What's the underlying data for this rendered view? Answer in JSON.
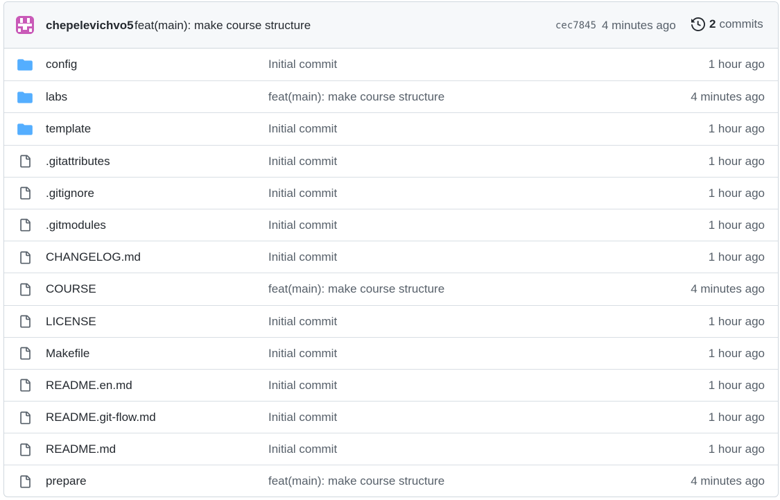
{
  "latest_commit": {
    "author": "chepelevichvo5",
    "message": "feat(main): make course structure",
    "sha": "cec7845",
    "time": "4 minutes ago",
    "commit_count": "2",
    "commits_label": "commits"
  },
  "colors": {
    "folder": "#54aeff",
    "avatar": "#c95ab8",
    "muted": "#57606a",
    "text": "#24292f"
  },
  "files": [
    {
      "type": "folder",
      "icon": "folder-icon",
      "name": "config",
      "message": "Initial commit",
      "time": "1 hour ago"
    },
    {
      "type": "folder",
      "icon": "folder-icon",
      "name": "labs",
      "message": "feat(main): make course structure",
      "time": "4 minutes ago"
    },
    {
      "type": "folder",
      "icon": "folder-icon",
      "name": "template",
      "message": "Initial commit",
      "time": "1 hour ago"
    },
    {
      "type": "file",
      "icon": "file-icon",
      "name": ".gitattributes",
      "message": "Initial commit",
      "time": "1 hour ago"
    },
    {
      "type": "file",
      "icon": "file-icon",
      "name": ".gitignore",
      "message": "Initial commit",
      "time": "1 hour ago"
    },
    {
      "type": "file",
      "icon": "file-icon",
      "name": ".gitmodules",
      "message": "Initial commit",
      "time": "1 hour ago"
    },
    {
      "type": "file",
      "icon": "file-icon",
      "name": "CHANGELOG.md",
      "message": "Initial commit",
      "time": "1 hour ago"
    },
    {
      "type": "file",
      "icon": "file-icon",
      "name": "COURSE",
      "message": "feat(main): make course structure",
      "time": "4 minutes ago"
    },
    {
      "type": "file",
      "icon": "file-icon",
      "name": "LICENSE",
      "message": "Initial commit",
      "time": "1 hour ago"
    },
    {
      "type": "file",
      "icon": "file-icon",
      "name": "Makefile",
      "message": "Initial commit",
      "time": "1 hour ago"
    },
    {
      "type": "file",
      "icon": "file-icon",
      "name": "README.en.md",
      "message": "Initial commit",
      "time": "1 hour ago"
    },
    {
      "type": "file",
      "icon": "file-icon",
      "name": "README.git-flow.md",
      "message": "Initial commit",
      "time": "1 hour ago"
    },
    {
      "type": "file",
      "icon": "file-icon",
      "name": "README.md",
      "message": "Initial commit",
      "time": "1 hour ago"
    },
    {
      "type": "file",
      "icon": "file-icon",
      "name": "prepare",
      "message": "feat(main): make course structure",
      "time": "4 minutes ago"
    }
  ]
}
